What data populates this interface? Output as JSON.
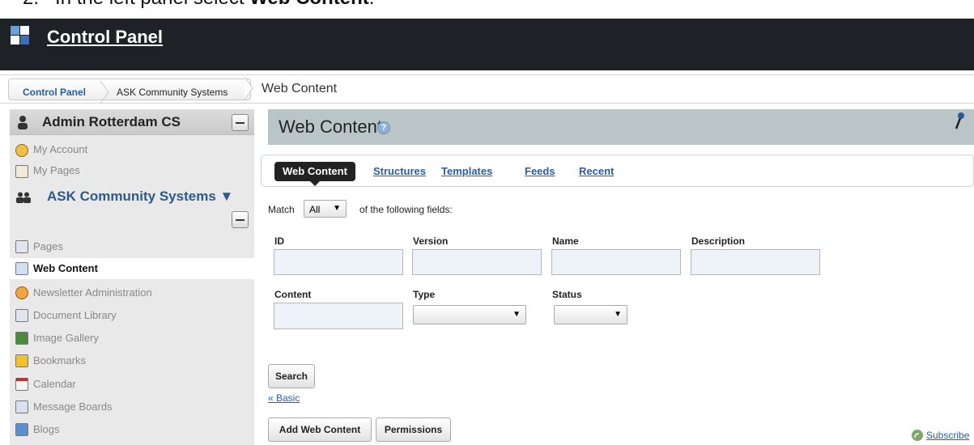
{
  "instruction": {
    "step": "2.",
    "text_before": "In the left panel select ",
    "bold": "Web Content",
    "text_after": "."
  },
  "header": {
    "title": "Control Panel"
  },
  "breadcrumb": {
    "items": [
      "Control Panel",
      "ASK Community Systems",
      "Web Content"
    ]
  },
  "sidebar": {
    "user_name": "Admin Rotterdam CS",
    "user_items": [
      {
        "label": "My Account",
        "icon": "account-icon"
      },
      {
        "label": "My Pages",
        "icon": "pages-icon"
      }
    ],
    "group_name": "ASK Community Systems ▼",
    "items": [
      {
        "label": "Pages",
        "icon": "pages-icon"
      },
      {
        "label": "Web Content",
        "icon": "web-content-icon",
        "active": true
      },
      {
        "label": "Newsletter Administration",
        "icon": "newsletter-icon"
      },
      {
        "label": "Document Library",
        "icon": "document-library-icon"
      },
      {
        "label": "Image Gallery",
        "icon": "image-gallery-icon"
      },
      {
        "label": "Bookmarks",
        "icon": "bookmarks-icon"
      },
      {
        "label": "Calendar",
        "icon": "calendar-icon"
      },
      {
        "label": "Message Boards",
        "icon": "message-boards-icon"
      },
      {
        "label": "Blogs",
        "icon": "blogs-icon"
      }
    ]
  },
  "main": {
    "title": "Web Content",
    "tabs": [
      {
        "label": "Web Content",
        "active": true
      },
      {
        "label": "Structures"
      },
      {
        "label": "Templates"
      },
      {
        "label": "Feeds"
      },
      {
        "label": "Recent"
      }
    ],
    "match": {
      "prefix": "Match",
      "value": "All",
      "suffix": "of the following fields:"
    },
    "fields": {
      "id": "ID",
      "version": "Version",
      "name": "Name",
      "description": "Description",
      "content": "Content",
      "type": "Type",
      "status": "Status"
    },
    "search_button": "Search",
    "basic_link": "« Basic",
    "add_button": "Add Web Content",
    "permissions_button": "Permissions",
    "subscribe_link": "Subscribe"
  },
  "colors": {
    "header_bg": "#1e2125",
    "accent_link": "#275ea3",
    "panel_head_bg": "#b9c5c7"
  }
}
